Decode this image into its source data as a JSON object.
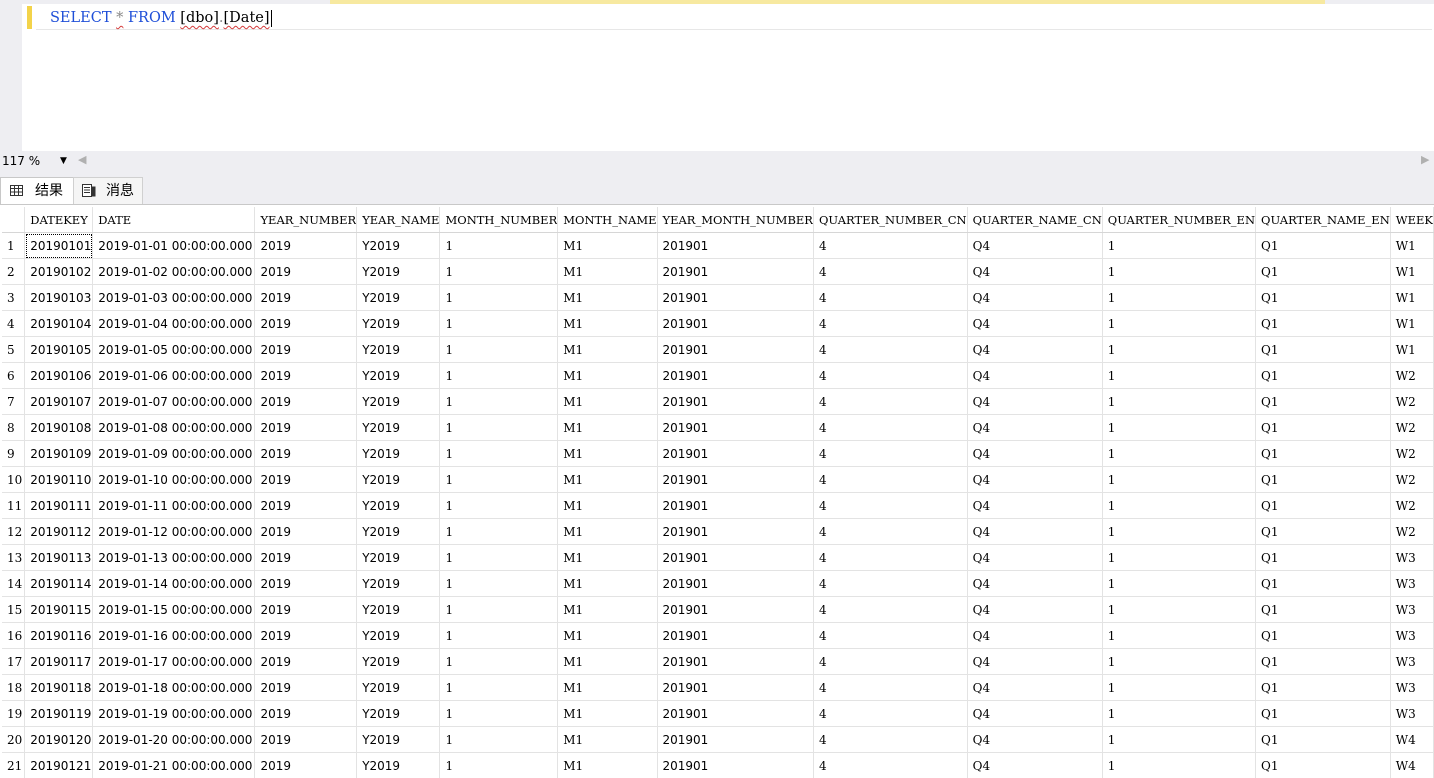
{
  "editor": {
    "query_tokens": {
      "select": "SELECT",
      "star": "*",
      "from": "FROM",
      "schema": "[dbo]",
      "dot": ".",
      "table": "[Date]"
    }
  },
  "zoom": {
    "value": "117 %"
  },
  "tabs": {
    "results": "结果",
    "messages": "消息"
  },
  "grid": {
    "columns": [
      "",
      "DATEKEY",
      "DATE",
      "YEAR_NUMBER",
      "YEAR_NAME",
      "MONTH_NUMBER",
      "MONTH_NAME",
      "YEAR_MONTH_NUMBER",
      "QUARTER_NUMBER_CN",
      "QUARTER_NAME_CN",
      "QUARTER_NUMBER_EN",
      "QUARTER_NAME_EN",
      "WEEK"
    ],
    "rows": [
      [
        "1",
        "20190101",
        "2019-01-01 00:00:00.000",
        "2019",
        "Y2019",
        "1",
        "M1",
        "201901",
        "4",
        "Q4",
        "1",
        "Q1",
        "W1"
      ],
      [
        "2",
        "20190102",
        "2019-01-02 00:00:00.000",
        "2019",
        "Y2019",
        "1",
        "M1",
        "201901",
        "4",
        "Q4",
        "1",
        "Q1",
        "W1"
      ],
      [
        "3",
        "20190103",
        "2019-01-03 00:00:00.000",
        "2019",
        "Y2019",
        "1",
        "M1",
        "201901",
        "4",
        "Q4",
        "1",
        "Q1",
        "W1"
      ],
      [
        "4",
        "20190104",
        "2019-01-04 00:00:00.000",
        "2019",
        "Y2019",
        "1",
        "M1",
        "201901",
        "4",
        "Q4",
        "1",
        "Q1",
        "W1"
      ],
      [
        "5",
        "20190105",
        "2019-01-05 00:00:00.000",
        "2019",
        "Y2019",
        "1",
        "M1",
        "201901",
        "4",
        "Q4",
        "1",
        "Q1",
        "W1"
      ],
      [
        "6",
        "20190106",
        "2019-01-06 00:00:00.000",
        "2019",
        "Y2019",
        "1",
        "M1",
        "201901",
        "4",
        "Q4",
        "1",
        "Q1",
        "W2"
      ],
      [
        "7",
        "20190107",
        "2019-01-07 00:00:00.000",
        "2019",
        "Y2019",
        "1",
        "M1",
        "201901",
        "4",
        "Q4",
        "1",
        "Q1",
        "W2"
      ],
      [
        "8",
        "20190108",
        "2019-01-08 00:00:00.000",
        "2019",
        "Y2019",
        "1",
        "M1",
        "201901",
        "4",
        "Q4",
        "1",
        "Q1",
        "W2"
      ],
      [
        "9",
        "20190109",
        "2019-01-09 00:00:00.000",
        "2019",
        "Y2019",
        "1",
        "M1",
        "201901",
        "4",
        "Q4",
        "1",
        "Q1",
        "W2"
      ],
      [
        "10",
        "20190110",
        "2019-01-10 00:00:00.000",
        "2019",
        "Y2019",
        "1",
        "M1",
        "201901",
        "4",
        "Q4",
        "1",
        "Q1",
        "W2"
      ],
      [
        "11",
        "20190111",
        "2019-01-11 00:00:00.000",
        "2019",
        "Y2019",
        "1",
        "M1",
        "201901",
        "4",
        "Q4",
        "1",
        "Q1",
        "W2"
      ],
      [
        "12",
        "20190112",
        "2019-01-12 00:00:00.000",
        "2019",
        "Y2019",
        "1",
        "M1",
        "201901",
        "4",
        "Q4",
        "1",
        "Q1",
        "W2"
      ],
      [
        "13",
        "20190113",
        "2019-01-13 00:00:00.000",
        "2019",
        "Y2019",
        "1",
        "M1",
        "201901",
        "4",
        "Q4",
        "1",
        "Q1",
        "W3"
      ],
      [
        "14",
        "20190114",
        "2019-01-14 00:00:00.000",
        "2019",
        "Y2019",
        "1",
        "M1",
        "201901",
        "4",
        "Q4",
        "1",
        "Q1",
        "W3"
      ],
      [
        "15",
        "20190115",
        "2019-01-15 00:00:00.000",
        "2019",
        "Y2019",
        "1",
        "M1",
        "201901",
        "4",
        "Q4",
        "1",
        "Q1",
        "W3"
      ],
      [
        "16",
        "20190116",
        "2019-01-16 00:00:00.000",
        "2019",
        "Y2019",
        "1",
        "M1",
        "201901",
        "4",
        "Q4",
        "1",
        "Q1",
        "W3"
      ],
      [
        "17",
        "20190117",
        "2019-01-17 00:00:00.000",
        "2019",
        "Y2019",
        "1",
        "M1",
        "201901",
        "4",
        "Q4",
        "1",
        "Q1",
        "W3"
      ],
      [
        "18",
        "20190118",
        "2019-01-18 00:00:00.000",
        "2019",
        "Y2019",
        "1",
        "M1",
        "201901",
        "4",
        "Q4",
        "1",
        "Q1",
        "W3"
      ],
      [
        "19",
        "20190119",
        "2019-01-19 00:00:00.000",
        "2019",
        "Y2019",
        "1",
        "M1",
        "201901",
        "4",
        "Q4",
        "1",
        "Q1",
        "W3"
      ],
      [
        "20",
        "20190120",
        "2019-01-20 00:00:00.000",
        "2019",
        "Y2019",
        "1",
        "M1",
        "201901",
        "4",
        "Q4",
        "1",
        "Q1",
        "W4"
      ],
      [
        "21",
        "20190121",
        "2019-01-21 00:00:00.000",
        "2019",
        "Y2019",
        "1",
        "M1",
        "201901",
        "4",
        "Q4",
        "1",
        "Q1",
        "W4"
      ]
    ]
  },
  "colors": {
    "editor_gutter": "#eeeef2",
    "change_marker": "#f3d34a",
    "keyword": "#1f4fd8",
    "squiggle": "#d43b3b"
  }
}
